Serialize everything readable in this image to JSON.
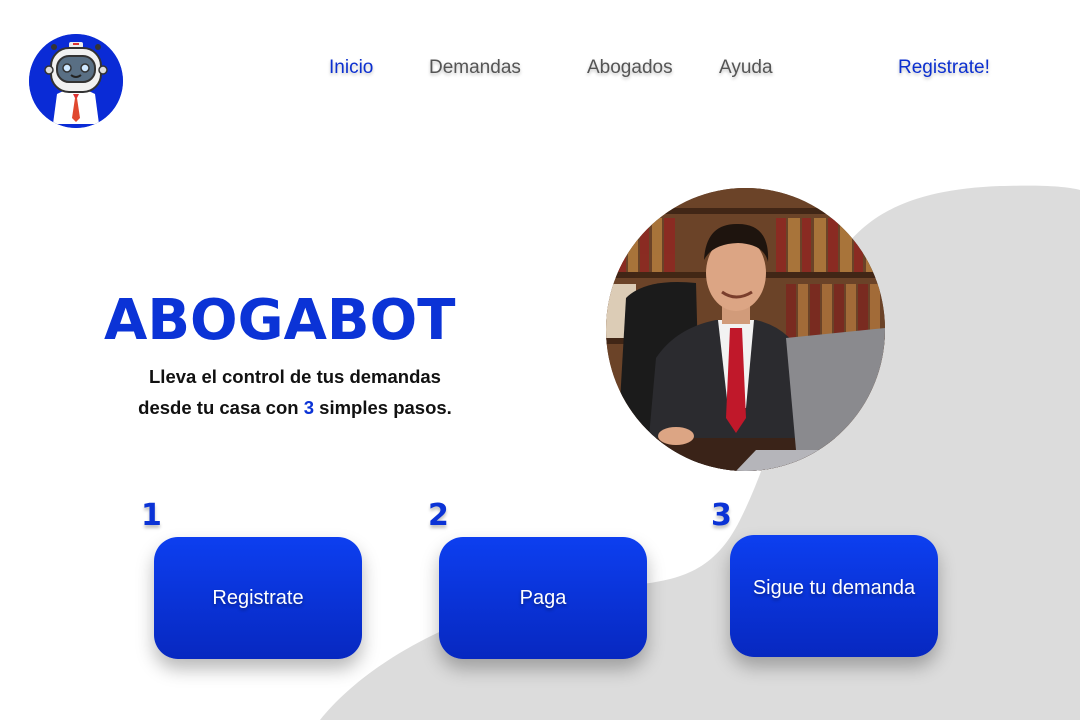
{
  "nav": {
    "items": [
      "Inicio",
      "Demandas",
      "Abogados",
      "Ayuda"
    ],
    "register": "Registrate!"
  },
  "hero": {
    "title": "ABOGABOT",
    "subtitle_line1": "Lleva el control de tus demandas",
    "subtitle_line2_pre": "desde tu casa con ",
    "subtitle_highlight": "3",
    "subtitle_line2_post": " simples pasos."
  },
  "steps": [
    {
      "number": "1",
      "label": "Registrate"
    },
    {
      "number": "2",
      "label": "Paga"
    },
    {
      "number": "3",
      "label": "Sigue tu demanda"
    }
  ],
  "colors": {
    "accent": "#0b33d6",
    "background_blob": "#dcdcdc",
    "nav_text": "#555555"
  },
  "icons": {
    "logo": "robot-lawyer-icon"
  }
}
